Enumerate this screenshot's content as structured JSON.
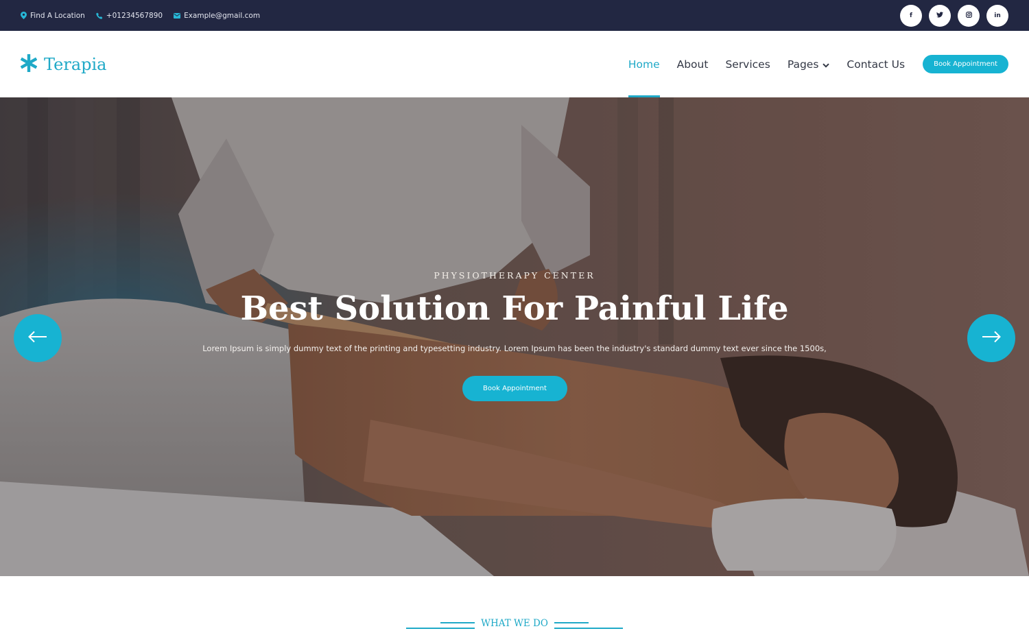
{
  "topbar": {
    "location": "Find A Location",
    "phone": "+01234567890",
    "email": "Example@gmail.com",
    "social": [
      {
        "icon": "facebook-icon",
        "glyph": "f"
      },
      {
        "icon": "twitter-icon",
        "glyph": "t"
      },
      {
        "icon": "instagram-icon",
        "glyph": "ig"
      },
      {
        "icon": "linkedin-icon",
        "glyph": "in"
      }
    ]
  },
  "header": {
    "brand": "Terapia",
    "nav": [
      "Home",
      "About",
      "Services",
      "Pages",
      "Contact Us"
    ],
    "active_nav": "Home",
    "book_label": "Book Appointment"
  },
  "hero": {
    "eyebrow": "PHYSIOTHERAPY CENTER",
    "title": "Best Solution For Painful Life",
    "text": "Lorem Ipsum is simply dummy text of the printing and typesetting industry. Lorem Ipsum has been the industry's standard dummy text ever since the 1500s,",
    "button": "Book Appointment"
  },
  "section": {
    "label": "WHAT WE DO"
  },
  "colors": {
    "accent": "#17b3d2",
    "topbar": "#222742",
    "text": "#333845"
  }
}
